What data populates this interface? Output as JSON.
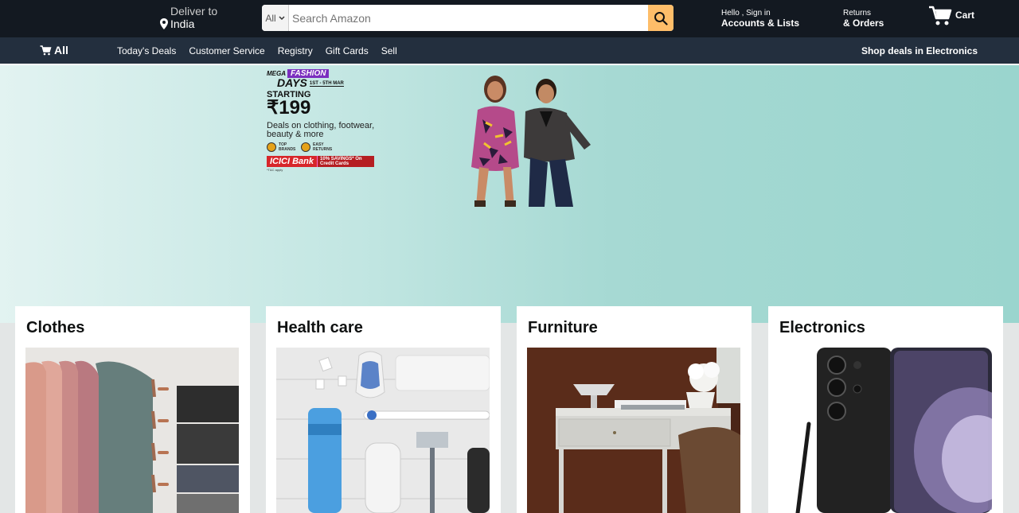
{
  "header": {
    "deliver_label": "Deliver to",
    "deliver_location": "India",
    "search_category": "All",
    "search_placeholder": "Search Amazon",
    "account_greeting": "Hello , Sign in",
    "account_label": "Accounts & Lists",
    "returns_label": "Returns",
    "orders_label": "& Orders",
    "cart_label": "Cart"
  },
  "nav": {
    "all_label": "All",
    "links": [
      "Today's Deals",
      "Customer Service",
      "Registry",
      "Gift Cards",
      "Sell"
    ],
    "promo_link": "Shop deals in Electronics"
  },
  "hero": {
    "mega": "MEGA",
    "fashion": "FASHION",
    "days": "DAYS",
    "dates": "1ST - 5TH MAR",
    "starting": "STARTING",
    "price": "₹199",
    "deals_text": "Deals on clothing, footwear, beauty & more",
    "badge_top": "TOP BRANDS",
    "badge_easy": "EASY RETURNS",
    "bank": "ICICI Bank",
    "savings": "10% SAVINGS* On Credit Cards",
    "tc": "*T&C apply"
  },
  "categories": [
    {
      "title": "Clothes"
    },
    {
      "title": "Health care"
    },
    {
      "title": "Furniture"
    },
    {
      "title": "Electronics"
    }
  ],
  "colors": {
    "header_bg": "#131921",
    "nav_bg": "#232f3e",
    "search_button": "#febd69",
    "page_bg": "#e3e6e6"
  }
}
